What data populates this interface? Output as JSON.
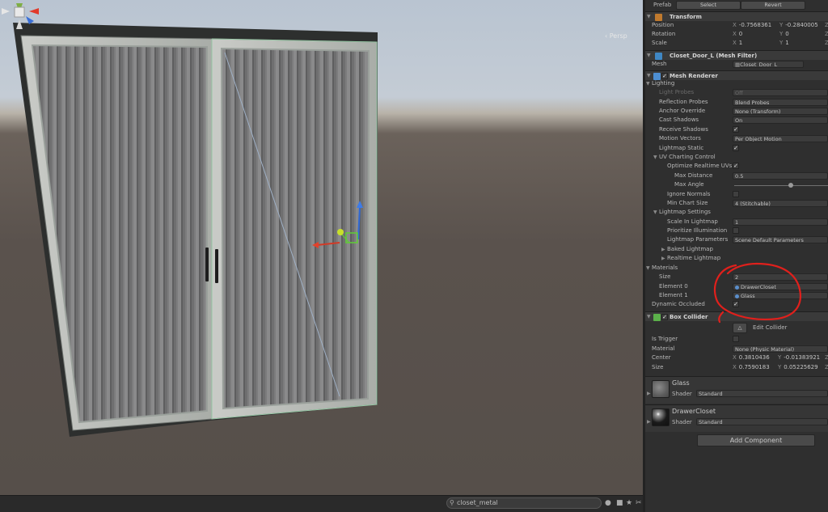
{
  "scene": {
    "persp_label": "‹ Persp",
    "search_value": "closet_metal",
    "bottom_icons": [
      "lock-icon",
      "layers-icon",
      "star-icon",
      "scissors-icon"
    ]
  },
  "prefab": {
    "label": "Prefab",
    "select_label": "Select",
    "revert_label": "Revert"
  },
  "transform": {
    "title": "Transform",
    "position_label": "Position",
    "position": {
      "x": "-0.7568361",
      "y": "-0.2840005"
    },
    "rotation_label": "Rotation",
    "rotation": {
      "x": "0",
      "y": "0"
    },
    "scale_label": "Scale",
    "scale": {
      "x": "1",
      "y": "1"
    }
  },
  "mesh_filter": {
    "title": "Closet_Door_L (Mesh Filter)",
    "mesh_label": "Mesh",
    "mesh_value": "Closet_Door_L"
  },
  "mesh_renderer": {
    "title": "Mesh Renderer",
    "lighting_label": "Lighting",
    "light_probes_label": "Light Probes",
    "light_probes_value": "Off",
    "reflection_probes_label": "Reflection Probes",
    "reflection_probes_value": "Blend Probes",
    "anchor_override_label": "Anchor Override",
    "anchor_override_value": "None (Transform)",
    "cast_shadows_label": "Cast Shadows",
    "cast_shadows_value": "On",
    "receive_shadows_label": "Receive Shadows",
    "motion_vectors_label": "Motion Vectors",
    "motion_vectors_value": "Per Object Motion",
    "lightmap_static_label": "Lightmap Static",
    "uv_charting_label": "UV Charting Control",
    "optimize_uvs_label": "Optimize Realtime UVs",
    "max_distance_label": "Max Distance",
    "max_distance_value": "0.5",
    "max_angle_label": "Max Angle",
    "max_angle_fraction": 0.6,
    "ignore_normals_label": "Ignore Normals",
    "min_chart_size_label": "Min Chart Size",
    "min_chart_size_value": "4 (Stitchable)",
    "lightmap_settings_label": "Lightmap Settings",
    "scale_in_lightmap_label": "Scale In Lightmap",
    "scale_in_lightmap_value": "1",
    "prioritize_illumination_label": "Prioritize Illumination",
    "lightmap_parameters_label": "Lightmap Parameters",
    "lightmap_parameters_value": "Scene Default Parameters",
    "baked_lightmap_label": "Baked Lightmap",
    "realtime_lightmap_label": "Realtime Lightmap",
    "materials_label": "Materials",
    "size_label": "Size",
    "size_value": "2",
    "element0_label": "Element 0",
    "element0_value": "DrawerCloset",
    "element1_label": "Element 1",
    "element1_value": "Glass",
    "dynamic_occluded_label": "Dynamic Occluded"
  },
  "box_collider": {
    "title": "Box Collider",
    "edit_collider_label": "Edit Collider",
    "is_trigger_label": "Is Trigger",
    "material_label": "Material",
    "material_value": "None (Physic Material)",
    "center_label": "Center",
    "center": {
      "x": "0.3810436",
      "y": "-0.01383921"
    },
    "size_label": "Size",
    "size": {
      "x": "0.7590183",
      "y": "0.05225629"
    }
  },
  "materials_preview": [
    {
      "name": "Glass",
      "shader_label": "Shader",
      "shader_value": "Standard"
    },
    {
      "name": "DrawerCloset",
      "shader_label": "Shader",
      "shader_value": "Standard"
    }
  ],
  "add_component_label": "Add Component",
  "axis": {
    "x": "X",
    "y": "Y",
    "z": "Z"
  },
  "colors": {
    "annotation": "#e0201c",
    "panel": "#2f2f2f",
    "header": "#3a3a3a",
    "scene_sky": "#c4ccd5",
    "scene_ground": "#564f4a"
  }
}
